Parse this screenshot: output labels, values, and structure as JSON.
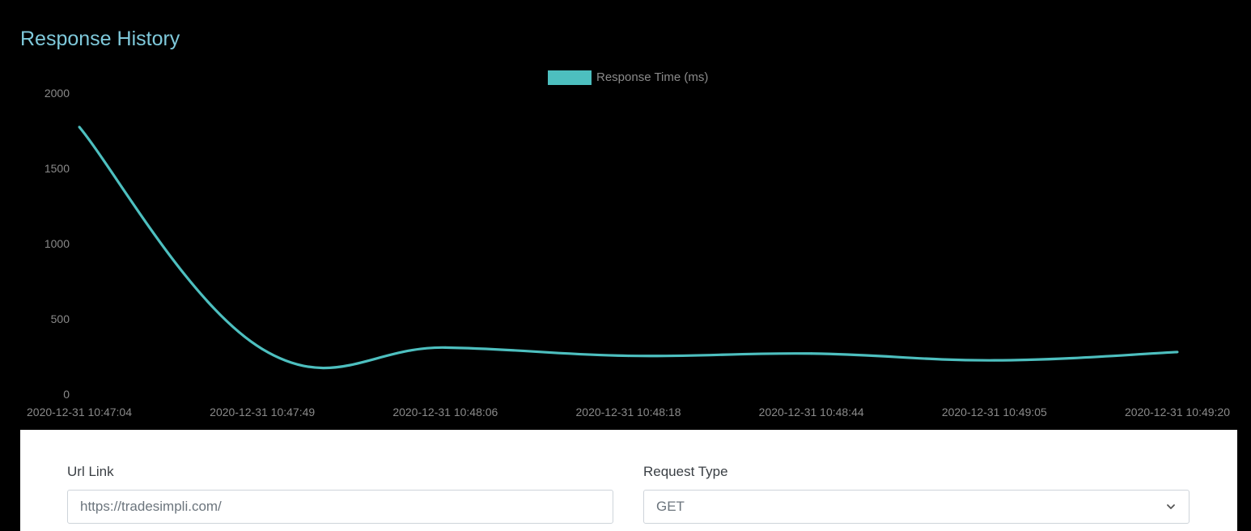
{
  "page": {
    "title": "Response History"
  },
  "chart_data": {
    "type": "line",
    "title": "",
    "xlabel": "",
    "ylabel": "",
    "categories": [
      "2020-12-31 10:47:04",
      "2020-12-31 10:47:49",
      "2020-12-31 10:48:06",
      "2020-12-31 10:48:18",
      "2020-12-31 10:48:44",
      "2020-12-31 10:49:05",
      "2020-12-31 10:49:20"
    ],
    "series": [
      {
        "name": "Response Time (ms)",
        "color": "#4dbfbf",
        "values": [
          1775,
          300,
          310,
          255,
          270,
          225,
          280
        ]
      }
    ],
    "ylim": [
      0,
      2000
    ],
    "yticks": [
      0,
      500,
      1000,
      1500,
      2000
    ],
    "grid": false,
    "legend_position": "top-center"
  },
  "form": {
    "url_label": "Url Link",
    "url_value": "https://tradesimpli.com/",
    "request_type_label": "Request Type",
    "request_type_value": "GET"
  }
}
